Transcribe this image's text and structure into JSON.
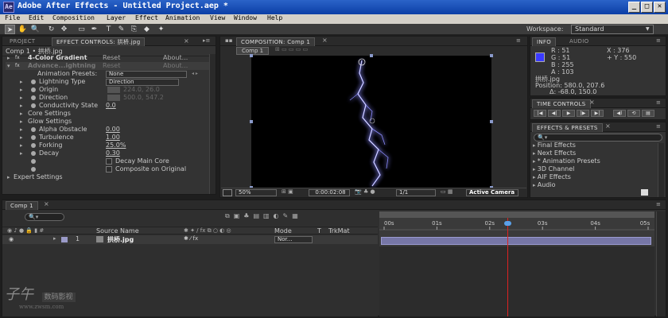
{
  "window": {
    "title": "Adobe After Effects - Untitled Project.aep *",
    "icon_text": "Ae",
    "min_label": "_",
    "max_label": "□",
    "close_label": "✕"
  },
  "menu": [
    "File",
    "Edit",
    "Composition",
    "Layer",
    "Effect",
    "Animation",
    "View",
    "Window",
    "Help"
  ],
  "tools": [
    "➤",
    "✋",
    "🔍",
    "↻",
    "✥",
    "▭",
    "✒",
    "T",
    "✎",
    "⎘",
    "◆",
    "✦"
  ],
  "workspace": {
    "label": "Workspace:",
    "value": "Standard"
  },
  "effect_panel": {
    "tab_project": "PROJECT",
    "tab_effects": "EFFECT CONTROLS: 拱桥.jpg",
    "header": "Comp 1 • 拱桥.jpg",
    "fx1": {
      "name": "4-Color Gradient",
      "reset": "Reset",
      "about": "About..."
    },
    "fx2": {
      "name": "Advance...ightning",
      "reset": "Reset",
      "about": "About..."
    },
    "rows": {
      "presets": {
        "label": "Animation Presets:",
        "value": "None"
      },
      "type": {
        "label": "Lightning Type",
        "value": "Direction"
      },
      "origin": {
        "label": "Origin",
        "value": "224.0, 26.0"
      },
      "direction": {
        "label": "Direction",
        "value": "500.0, 547.2"
      },
      "conductivity": {
        "label": "Conductivity State",
        "value": "0.0"
      },
      "core": {
        "label": "Core Settings"
      },
      "glow": {
        "label": "Glow Settings"
      },
      "alpha": {
        "label": "Alpha Obstacle",
        "value": "0.00"
      },
      "turbulence": {
        "label": "Turbulence",
        "value": "1.00"
      },
      "forking": {
        "label": "Forking",
        "value": "25.0%"
      },
      "decay": {
        "label": "Decay",
        "value": "0.30"
      },
      "decay_main": {
        "label": "Decay Main Core"
      },
      "composite": {
        "label": "Composite on Original"
      },
      "expert": {
        "label": "Expert Settings"
      }
    }
  },
  "comp_panel": {
    "tab": "COMPOSITION: Comp 1",
    "subtab": "Comp 1",
    "zoom": "50%",
    "timecode": "0:00:02:08",
    "resolution": "1/1",
    "camera": "Active Camera"
  },
  "info_panel": {
    "tab_info": "INFO",
    "tab_audio": "AUDIO",
    "swatch_color": "#3a3aff",
    "r": "R : 51",
    "g": "G : 51",
    "b": "B : 255",
    "a": "A : 103",
    "x": "X : 376",
    "y": "+ Y : 550",
    "file": "拱桥.jpg",
    "position": "Position: 580.0, 207.6",
    "delta": "Δ: -68.0, 150.0"
  },
  "time_controls": {
    "tab": "TIME CONTROLS",
    "buttons": [
      "|◀",
      "◀|",
      "▶",
      "|▶",
      "▶|",
      "◀)",
      "⟲",
      "▤"
    ]
  },
  "effects_presets": {
    "tab": "EFFECTS & PRESETS",
    "search_placeholder": "🔍▾",
    "items": [
      "Final Effects",
      "Next Effects",
      "* Animation Presets",
      "3D Channel",
      "AIF Effects",
      "Audio"
    ]
  },
  "timeline": {
    "tab": "Comp 1",
    "search_placeholder": "🔍▾",
    "col_source": "Source Name",
    "col_mode": "Mode",
    "col_t": "T",
    "col_trkmat": "TrkMat",
    "layer": {
      "index": "1",
      "name": "拱桥.jpg",
      "mode": "Nor..."
    },
    "ruler": [
      "00s",
      "01s",
      "02s",
      "03s",
      "04s",
      "05s"
    ],
    "playhead_seconds": 2.33,
    "duration_seconds": 5
  },
  "watermark": {
    "logo": "子午",
    "text": "数码影视",
    "url": "www.zwsm.com"
  }
}
